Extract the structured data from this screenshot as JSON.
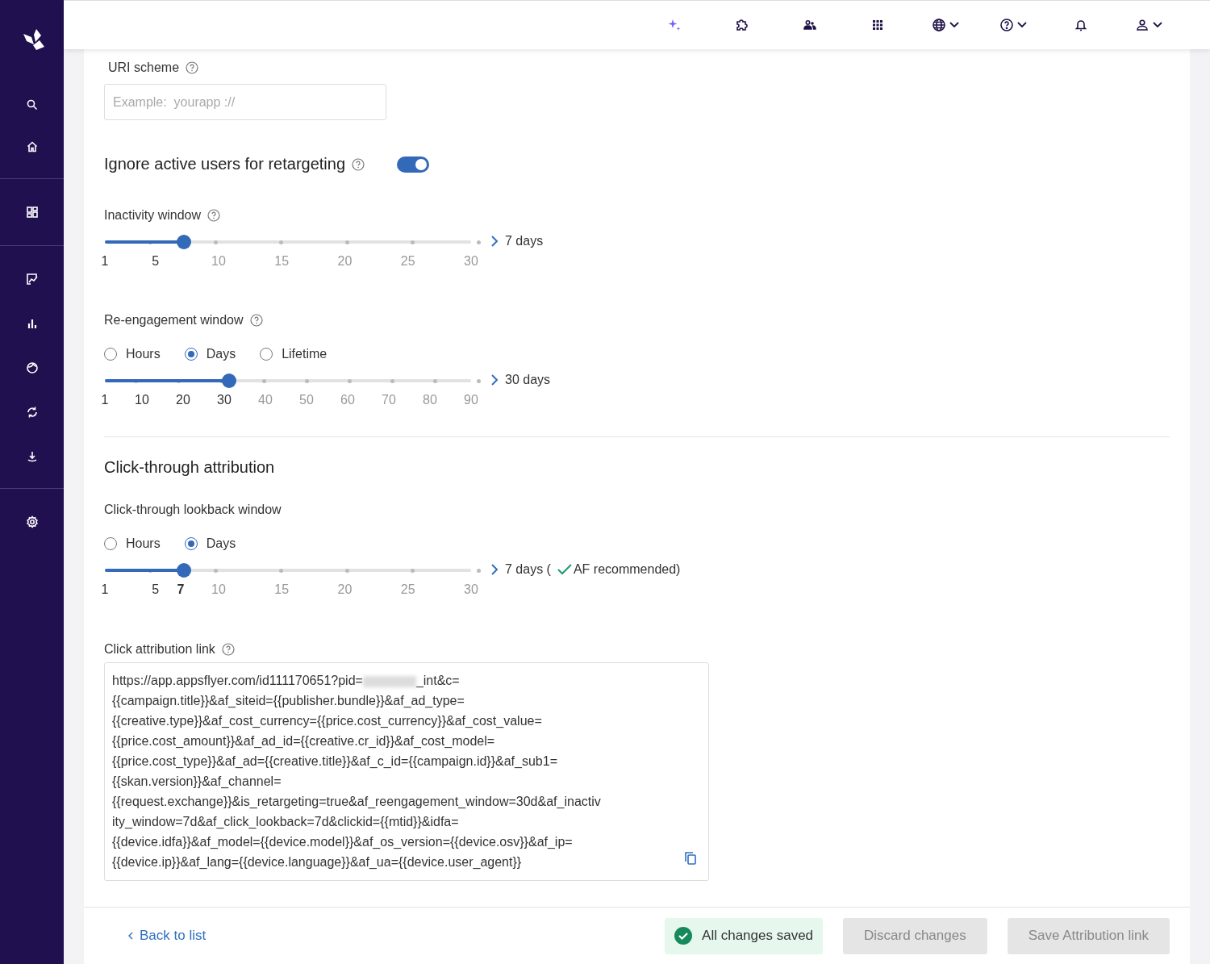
{
  "topbar": {
    "items": [
      {
        "menu": false
      },
      {
        "menu": false
      },
      {
        "menu": false
      },
      {
        "menu": false
      },
      {
        "menu": true
      },
      {
        "menu": true
      },
      {
        "menu": false
      },
      {
        "menu": true
      }
    ]
  },
  "uri_scheme": {
    "label": "URI scheme",
    "placeholder": "Example:  yourapp ://"
  },
  "retargeting": {
    "title": "Ignore active users for retargeting",
    "on": true
  },
  "inactivity": {
    "label": "Inactivity window",
    "level": 0.207,
    "reading": "7 days",
    "ticks": [
      {
        "label": "1",
        "active": true,
        "selected": false
      },
      {
        "label": "5",
        "active": true,
        "selected": false
      },
      {
        "label": "10",
        "active": false,
        "selected": false
      },
      {
        "label": "15",
        "active": false,
        "selected": false
      },
      {
        "label": "20",
        "active": false,
        "selected": false
      },
      {
        "label": "25",
        "active": false,
        "selected": false
      },
      {
        "label": "30",
        "active": false,
        "selected": false
      }
    ]
  },
  "reengagement": {
    "label": "Re-engagement window",
    "options": [
      {
        "label": "Hours",
        "selected": false
      },
      {
        "label": "Days",
        "selected": true
      },
      {
        "label": "Lifetime",
        "selected": false
      }
    ],
    "level": 0.326,
    "reading": "30 days",
    "ticks": [
      {
        "label": "1",
        "active": true,
        "selected": false
      },
      {
        "label": "10",
        "active": true,
        "selected": false
      },
      {
        "label": "20",
        "active": true,
        "selected": false
      },
      {
        "label": "30",
        "active": true,
        "selected": false
      },
      {
        "label": "40",
        "active": false,
        "selected": false
      },
      {
        "label": "50",
        "active": false,
        "selected": false
      },
      {
        "label": "60",
        "active": false,
        "selected": false
      },
      {
        "label": "70",
        "active": false,
        "selected": false
      },
      {
        "label": "80",
        "active": false,
        "selected": false
      },
      {
        "label": "90",
        "active": false,
        "selected": false
      }
    ]
  },
  "click_through": {
    "title": "Click-through attribution",
    "label": "Click-through lookback window",
    "options": [
      {
        "label": "Hours",
        "selected": false
      },
      {
        "label": "Days",
        "selected": true
      }
    ],
    "level": 0.207,
    "reading": "7 days (",
    "recommended": "AF recommended)",
    "ticks": [
      {
        "label": "1",
        "active": true,
        "selected": false
      },
      {
        "label": "5",
        "active": true,
        "selected": false
      },
      {
        "label": "7",
        "active": true,
        "selected": true
      },
      {
        "label": "10",
        "active": false,
        "selected": false
      },
      {
        "label": "15",
        "active": false,
        "selected": false
      },
      {
        "label": "20",
        "active": false,
        "selected": false
      },
      {
        "label": "25",
        "active": false,
        "selected": false
      },
      {
        "label": "30",
        "active": false,
        "selected": false
      }
    ]
  },
  "click_link": {
    "label": "Click attribution link",
    "lines": [
      [
        {
          "kind": "text",
          "text": "https://app.appsflyer.com/id111170651?pid="
        },
        {
          "kind": "redacted"
        },
        {
          "kind": "text",
          "text": "_int&c="
        }
      ],
      [
        {
          "kind": "text",
          "text": "{{campaign.title}}&af_siteid={{publisher.bundle}}&af_ad_type="
        }
      ],
      [
        {
          "kind": "text",
          "text": "{{creative.type}}&af_cost_currency={{price.cost_currency}}&af_cost_value="
        }
      ],
      [
        {
          "kind": "text",
          "text": "{{price.cost_amount}}&af_ad_id={{creative.cr_id}}&af_cost_model="
        }
      ],
      [
        {
          "kind": "text",
          "text": "{{price.cost_type}}&af_ad={{creative.title}}&af_c_id={{campaign.id}}&af_sub1="
        }
      ],
      [
        {
          "kind": "text",
          "text": "{{skan.version}}&af_channel="
        }
      ],
      [
        {
          "kind": "text",
          "text": "{{request.exchange}}&is_retargeting=true&af_reengagement_window=30d&af_inactiv"
        }
      ],
      [
        {
          "kind": "text",
          "text": "ity_window=7d&af_click_lookback=7d&clickid={{mtid}}&idfa="
        }
      ],
      [
        {
          "kind": "text",
          "text": "{{device.idfa}}&af_model={{device.model}}&af_os_version={{device.osv}}&af_ip="
        }
      ],
      [
        {
          "kind": "text",
          "text": "{{device.ip}}&af_lang={{device.language}}&af_ua={{device.user_agent}}"
        }
      ]
    ]
  },
  "footer": {
    "back": "Back to list",
    "status": "All changes saved",
    "discard": "Discard changes",
    "save": "Save Attribution link",
    "discard_disabled": true,
    "save_disabled": true
  }
}
